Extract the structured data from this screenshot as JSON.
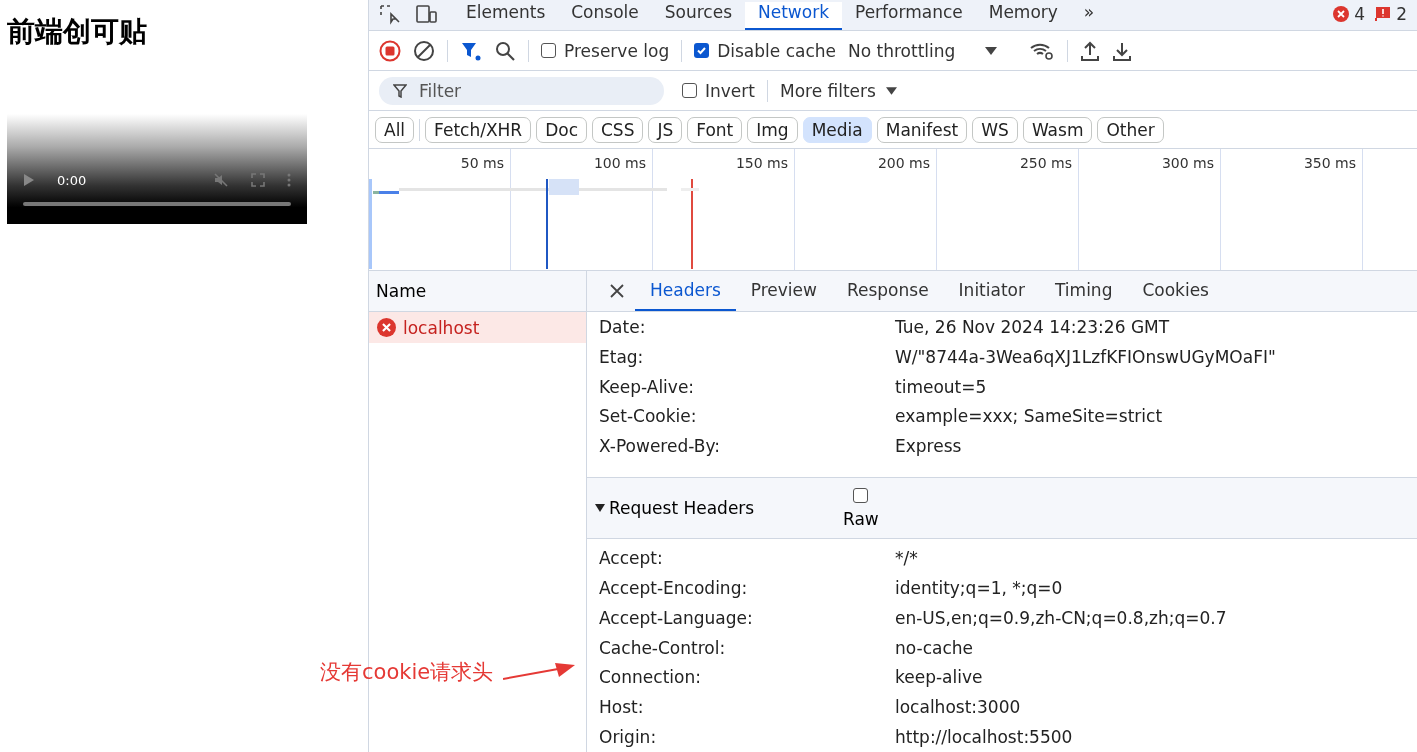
{
  "page": {
    "title": "前端创可贴",
    "video": {
      "time": "0:00",
      "muted": true
    }
  },
  "devtools": {
    "tabs": [
      {
        "label": "Elements",
        "selected": false
      },
      {
        "label": "Console",
        "selected": false
      },
      {
        "label": "Sources",
        "selected": false
      },
      {
        "label": "Network",
        "selected": true
      },
      {
        "label": "Performance",
        "selected": false
      },
      {
        "label": "Memory",
        "selected": false
      }
    ],
    "more": "»",
    "errors": "4",
    "issues": "2",
    "toolbar": {
      "preserve_log": {
        "label": "Preserve log",
        "checked": false
      },
      "disable_cache": {
        "label": "Disable cache",
        "checked": true
      },
      "throttling": "No throttling"
    },
    "filter": {
      "placeholder": "Filter",
      "invert": {
        "label": "Invert",
        "checked": false
      },
      "more_filters": "More filters"
    },
    "types": [
      {
        "label": "All",
        "selected": false
      },
      {
        "label": "Fetch/XHR",
        "selected": false
      },
      {
        "label": "Doc",
        "selected": false
      },
      {
        "label": "CSS",
        "selected": false
      },
      {
        "label": "JS",
        "selected": false
      },
      {
        "label": "Font",
        "selected": false
      },
      {
        "label": "Img",
        "selected": false
      },
      {
        "label": "Media",
        "selected": true
      },
      {
        "label": "Manifest",
        "selected": false
      },
      {
        "label": "WS",
        "selected": false
      },
      {
        "label": "Wasm",
        "selected": false
      },
      {
        "label": "Other",
        "selected": false
      }
    ],
    "timeline": {
      "ticks": [
        "50 ms",
        "100 ms",
        "150 ms",
        "200 ms",
        "250 ms",
        "300 ms",
        "350 ms"
      ]
    },
    "requests": {
      "column": "Name",
      "rows": [
        {
          "name": "localhost",
          "failed": true,
          "selected": true
        }
      ]
    },
    "detail_tabs": [
      {
        "label": "Headers",
        "selected": true
      },
      {
        "label": "Preview",
        "selected": false
      },
      {
        "label": "Response",
        "selected": false
      },
      {
        "label": "Initiator",
        "selected": false
      },
      {
        "label": "Timing",
        "selected": false
      },
      {
        "label": "Cookies",
        "selected": false
      }
    ],
    "response_headers": [
      {
        "name": "Date:",
        "value": "Tue, 26 Nov 2024 14:23:26 GMT"
      },
      {
        "name": "Etag:",
        "value": "W/\"8744a-3Wea6qXJ1LzfKFIOnswUGyMOaFI\""
      },
      {
        "name": "Keep-Alive:",
        "value": "timeout=5"
      },
      {
        "name": "Set-Cookie:",
        "value": "example=xxx; SameSite=strict"
      },
      {
        "name": "X-Powered-By:",
        "value": "Express"
      }
    ],
    "request_section": {
      "title": "Request Headers",
      "expanded": true,
      "raw": {
        "label": "Raw",
        "checked": false
      }
    },
    "request_headers": [
      {
        "name": "Accept:",
        "value": "*/*"
      },
      {
        "name": "Accept-Encoding:",
        "value": "identity;q=1, *;q=0"
      },
      {
        "name": "Accept-Language:",
        "value": "en-US,en;q=0.9,zh-CN;q=0.8,zh;q=0.7"
      },
      {
        "name": "Cache-Control:",
        "value": "no-cache"
      },
      {
        "name": "Connection:",
        "value": "keep-alive"
      },
      {
        "name": "Host:",
        "value": "localhost:3000"
      },
      {
        "name": "Origin:",
        "value": "http://localhost:5500"
      }
    ]
  },
  "annotation": {
    "text": "没有cookie请求头"
  }
}
